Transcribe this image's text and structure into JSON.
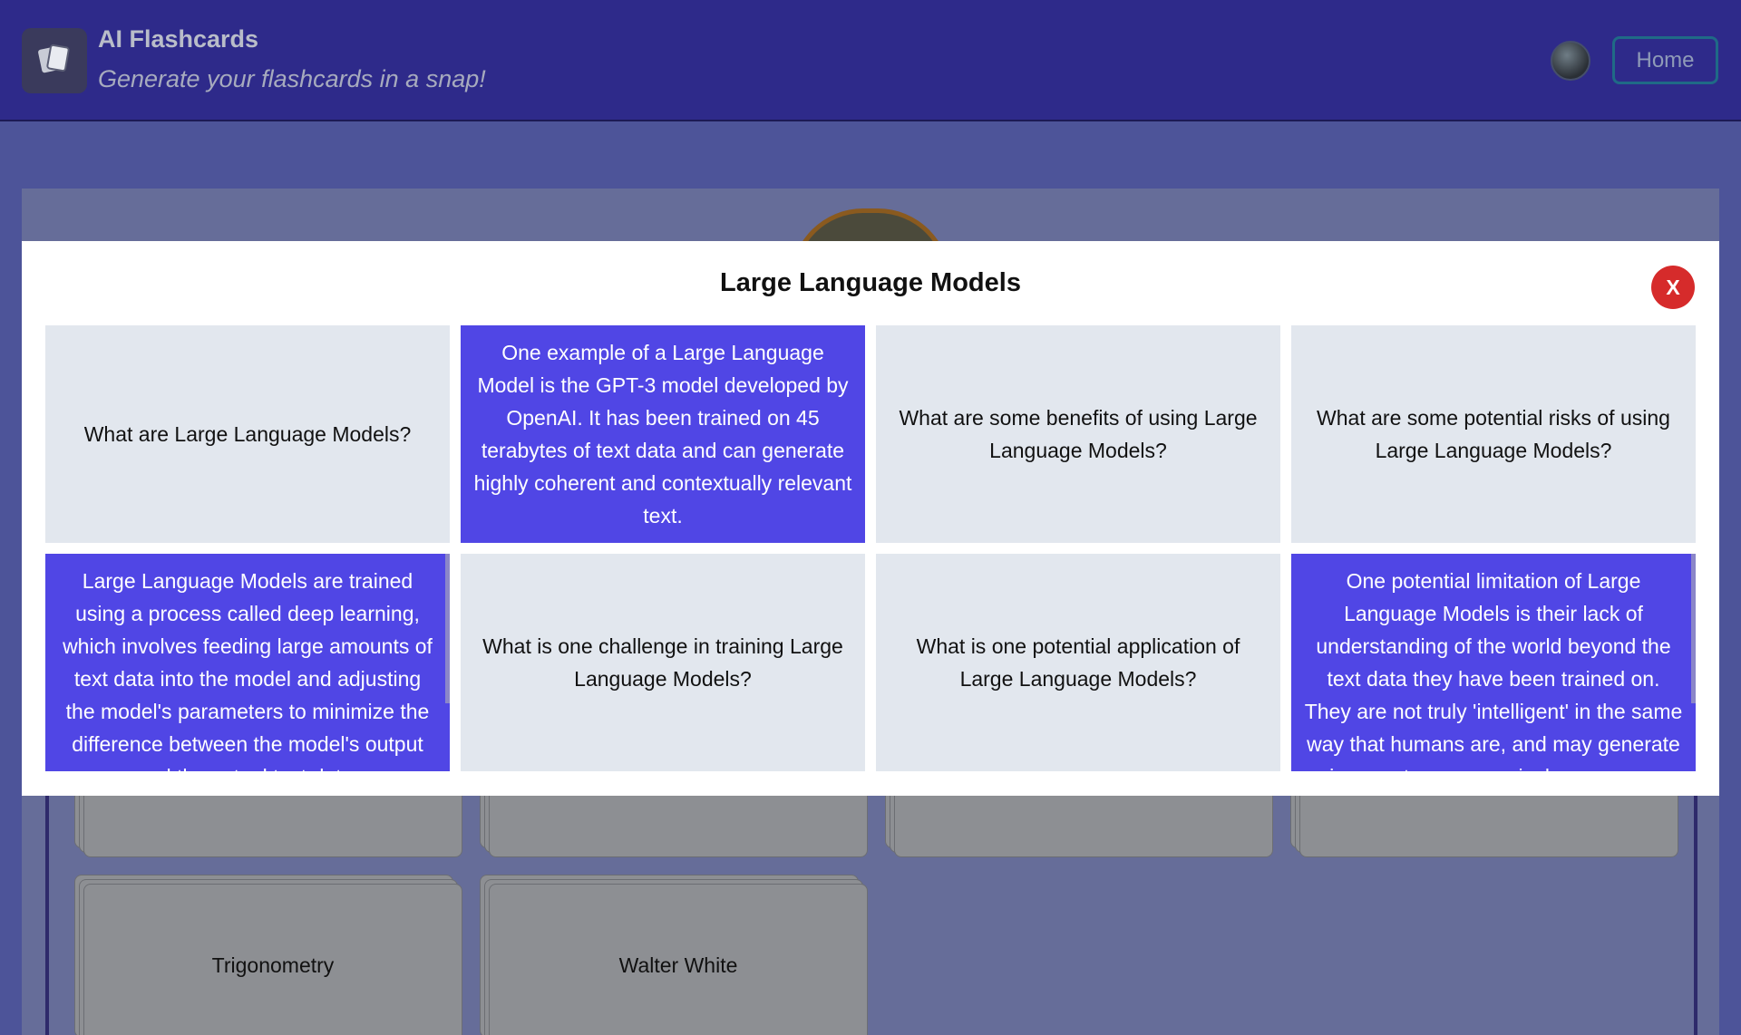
{
  "header": {
    "app_title": "AI Flashcards",
    "app_subtitle": "Generate your flashcards in a snap!",
    "home_label": "Home"
  },
  "modal": {
    "title": "Large Language Models",
    "close_label": "X",
    "cards": [
      {
        "text": "What are Large Language Models?",
        "flipped": false
      },
      {
        "text": "One example of a Large Language Model is the GPT-3 model developed by OpenAI. It has been trained on 45 terabytes of text data and can generate highly coherent and contextually relevant text.",
        "flipped": true
      },
      {
        "text": "What are some benefits of using Large Language Models?",
        "flipped": false
      },
      {
        "text": "What are some potential risks of using Large Language Models?",
        "flipped": false
      },
      {
        "text": "Large Language Models are trained using a process called deep learning, which involves feeding large amounts of text data into the model and adjusting the model's parameters to minimize the difference between the model's output and the actual text data.",
        "flipped": true
      },
      {
        "text": "What is one challenge in training Large Language Models?",
        "flipped": false
      },
      {
        "text": "What is one potential application of Large Language Models?",
        "flipped": false
      },
      {
        "text": "One potential limitation of Large Language Models is their lack of understanding of the world beyond the text data they have been trained on. They are not truly 'intelligent' in the same way that humans are, and may generate incorrect or nonsensical responses.",
        "flipped": true
      }
    ]
  },
  "decks": {
    "visible": [
      "Trigonometry",
      "Walter White"
    ]
  },
  "colors": {
    "header_bg": "#2e2a8a",
    "flipped_card": "#5046e5",
    "question_card": "#e2e7ee",
    "close_button": "#d62b2b"
  }
}
